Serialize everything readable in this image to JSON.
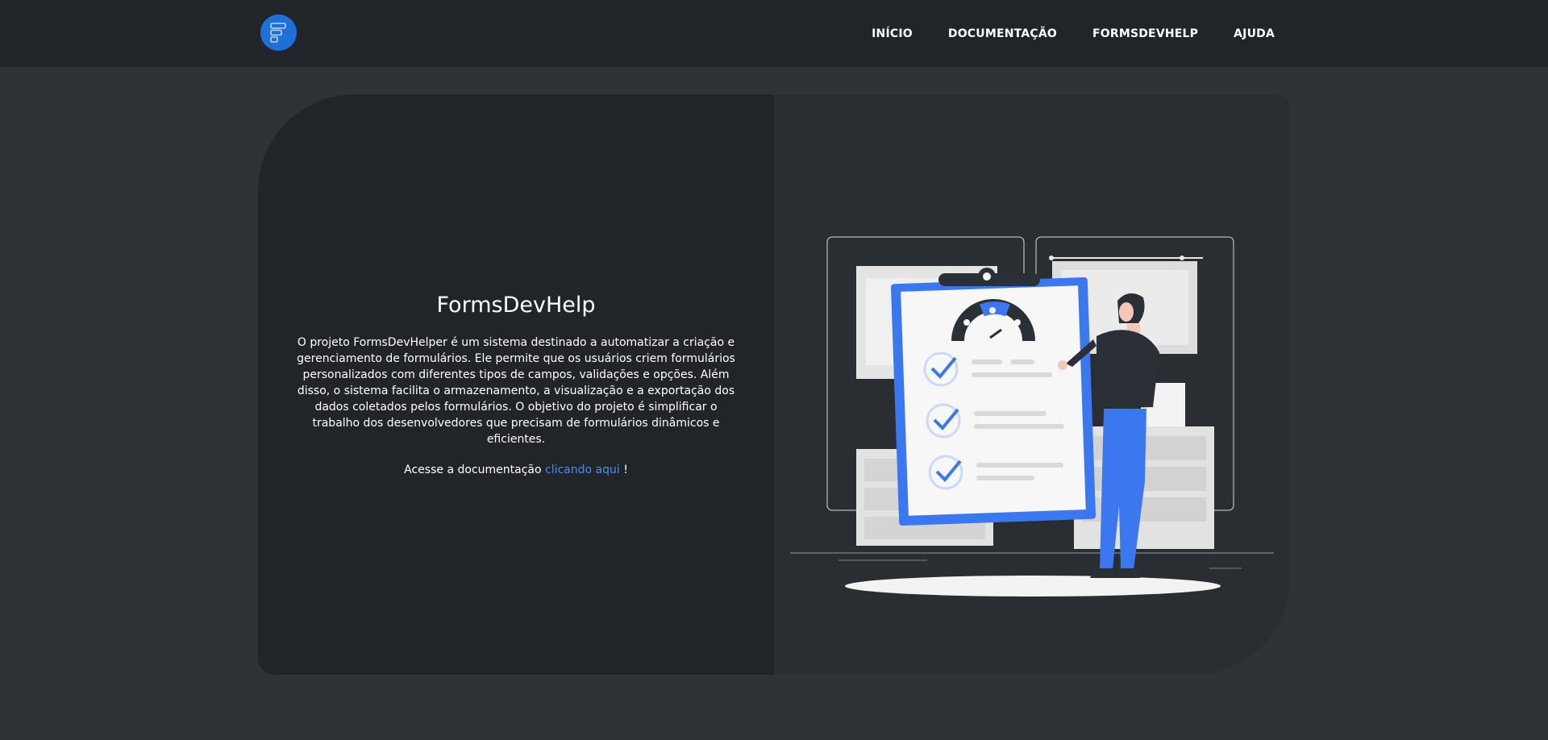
{
  "nav": {
    "logo_alt": "FormsDevHelp logo",
    "links": [
      {
        "label": "INÍCIO"
      },
      {
        "label": "DOCUMENTAÇÃO"
      },
      {
        "label": "FORMSDEVHELP"
      },
      {
        "label": "AJUDA"
      }
    ]
  },
  "hero": {
    "title": "FormsDevHelp",
    "description": "O projeto FormsDevHelper é um sistema destinado a automatizar a criação e gerenciamento de formulários. Ele permite que os usuários criem formulários personalizados com diferentes tipos de campos, validações e opções. Além disso, o sistema facilita o armazenamento, a visualização e a exportação dos dados coletados pelos formulários. O objetivo do projeto é simplificar o trabalho dos desenvolvedores que precisam de formulários dinâmicos e eficientes.",
    "cta_prefix": "Acesse a documentação ",
    "cta_link": "clicando aqui",
    "cta_suffix": " !"
  },
  "colors": {
    "navbar_bg": "#212428",
    "page_bg": "#2f3338",
    "card_left_bg": "#212428",
    "card_right_bg": "#2a2d31",
    "accent": "#3b78f0",
    "link": "#4a8ef0"
  }
}
